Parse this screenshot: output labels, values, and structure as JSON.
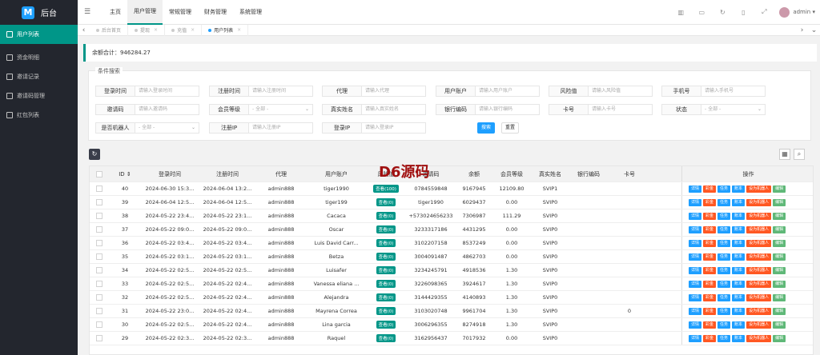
{
  "app": {
    "logo_letter": "M",
    "title": "后台"
  },
  "sidebar": {
    "items": [
      {
        "label": "用户列表",
        "icon": "user-icon",
        "active": true
      },
      {
        "label": "资金明细",
        "icon": "list-icon"
      },
      {
        "label": "邀请记录",
        "icon": "list-icon"
      },
      {
        "label": "邀请码管理",
        "icon": "list-icon"
      },
      {
        "label": "红包列表",
        "icon": "list-icon"
      }
    ]
  },
  "topbar": {
    "menu_toggle_icon": "menu-icon",
    "menu": [
      "主页",
      "用户管理",
      "常规管理",
      "财务管理",
      "系统管理"
    ],
    "active_menu": "用户管理",
    "tools": [
      "chart-icon",
      "screen-icon",
      "refresh-icon",
      "trash-icon",
      "fullscreen-icon"
    ],
    "user": "admin",
    "user_caret": "▾"
  },
  "tabs": {
    "left": "‹",
    "right": "›",
    "down": "⌄",
    "items": [
      "后台首页",
      "提现",
      "充值",
      "用户列表"
    ],
    "close": "×",
    "active": "用户列表"
  },
  "balance": {
    "text": "余额合计：946284.27"
  },
  "search": {
    "legend": "条件搜索",
    "search_btn": "搜索",
    "reset_btn": "重置",
    "fields": [
      {
        "label": "登录时间",
        "placeholder": "请输入登录时间"
      },
      {
        "label": "注册时间",
        "placeholder": "请输入注册时间"
      },
      {
        "label": "代理",
        "placeholder": "请输入代理"
      },
      {
        "label": "用户账户",
        "placeholder": "请输入用户账户"
      },
      {
        "label": "风险值",
        "placeholder": "请输入风险值"
      },
      {
        "label": "手机号",
        "placeholder": "请输入手机号"
      },
      {
        "label": "邀请码",
        "placeholder": "请输入邀请码"
      },
      {
        "label": "会员等级",
        "placeholder": "- 全部 -",
        "select": true
      },
      {
        "label": "真实姓名",
        "placeholder": "请输入真实姓名"
      },
      {
        "label": "银行编码",
        "placeholder": "请输入银行编码"
      },
      {
        "label": "卡号",
        "placeholder": "请输入卡号"
      },
      {
        "label": "状态",
        "placeholder": "- 全部 -",
        "select": true
      },
      {
        "label": "是否机器人",
        "placeholder": "- 全部 -",
        "select": true
      },
      {
        "label": "注册IP",
        "placeholder": "请输入注册IP"
      },
      {
        "label": "登录IP",
        "placeholder": "请输入登录IP"
      }
    ]
  },
  "toolbar": {
    "refresh": "↻",
    "columns": "▦",
    "search": "⌕"
  },
  "table": {
    "headers": [
      "ID ⇕",
      "登录时间",
      "注册时间",
      "代理",
      "用户账户",
      "风险值",
      "邀请码",
      "余额",
      "会员等级",
      "真实姓名",
      "银行编码",
      "卡号",
      "操作"
    ],
    "ops": [
      "详情",
      "彩金",
      "任务",
      "账本",
      "设为机器人",
      "编辑"
    ],
    "rows": [
      [
        "40",
        "2024-06-30 15:3...",
        "2024-06-04 13:2...",
        "admin888",
        "tiger1990",
        "查看(100)",
        "0784559848",
        "9167945",
        "12109.80",
        "SVIP1",
        "",
        "",
        ""
      ],
      [
        "39",
        "2024-06-04 12:5...",
        "2024-06-04 12:5...",
        "admin888",
        "tiger199",
        "查看(0)",
        "tiger1990",
        "6029437",
        "0.00",
        "SVIP0",
        "",
        "",
        ""
      ],
      [
        "38",
        "2024-05-22 23:4...",
        "2024-05-22 23:1...",
        "admin888",
        "Cacaca",
        "查看(0)",
        "+573024656233",
        "7306987",
        "111.29",
        "SVIP0",
        "",
        "",
        ""
      ],
      [
        "37",
        "2024-05-22 09:0...",
        "2024-05-22 09:0...",
        "admin888",
        "Oscar",
        "查看(0)",
        "3233317186",
        "4431295",
        "0.00",
        "SVIP0",
        "",
        "",
        ""
      ],
      [
        "36",
        "2024-05-22 03:4...",
        "2024-05-22 03:4...",
        "admin888",
        "Luis David Carr...",
        "查看(0)",
        "3102207158",
        "8537249",
        "0.00",
        "SVIP0",
        "",
        "",
        ""
      ],
      [
        "35",
        "2024-05-22 03:1...",
        "2024-05-22 03:1...",
        "admin888",
        "Betza",
        "查看(0)",
        "3004091487",
        "4862703",
        "0.00",
        "SVIP0",
        "",
        "",
        ""
      ],
      [
        "34",
        "2024-05-22 02:5...",
        "2024-05-22 02:5...",
        "admin888",
        "Luisafer",
        "查看(0)",
        "3234245791",
        "4918536",
        "1.30",
        "SVIP0",
        "",
        "",
        ""
      ],
      [
        "33",
        "2024-05-22 02:5...",
        "2024-05-22 02:4...",
        "admin888",
        "Vanessa eliana ...",
        "查看(0)",
        "3226098365",
        "3924617",
        "1.30",
        "SVIP0",
        "",
        "",
        ""
      ],
      [
        "32",
        "2024-05-22 02:5...",
        "2024-05-22 02:4...",
        "admin888",
        "Alejandra",
        "查看(0)",
        "3144429355",
        "4140893",
        "1.30",
        "SVIP0",
        "",
        "",
        ""
      ],
      [
        "31",
        "2024-05-22 23:0...",
        "2024-05-22 02:4...",
        "admin888",
        "Mayrena Correa",
        "查看(0)",
        "3103020748",
        "9961704",
        "1.30",
        "SVIP0",
        "",
        "0",
        ""
      ],
      [
        "30",
        "2024-05-22 02:5...",
        "2024-05-22 02:4...",
        "admin888",
        "Lina garcia",
        "查看(0)",
        "3006296355",
        "8274918",
        "1.30",
        "SVIP0",
        "",
        "",
        ""
      ],
      [
        "29",
        "2024-05-22 02:3...",
        "2024-05-22 02:3...",
        "admin888",
        "Raquel",
        "查看(0)",
        "3162956437",
        "7017932",
        "0.00",
        "SVIP0",
        "",
        "",
        ""
      ]
    ]
  },
  "watermark": "D6源码",
  "colors": {
    "sidebar": "#23262e",
    "accent": "#009688",
    "primary": "#1e9fff",
    "danger": "#ff5722",
    "success": "#5fb878"
  }
}
